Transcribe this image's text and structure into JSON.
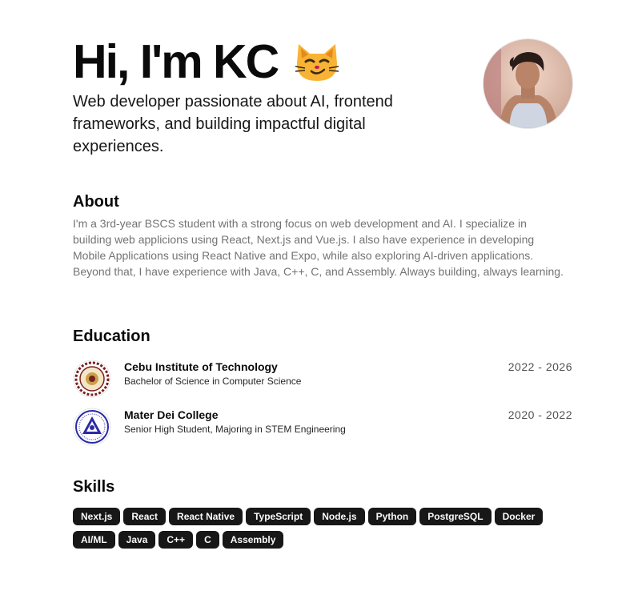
{
  "hero": {
    "title": "Hi, I'm KC",
    "emoji_icon": "smirking-cat-emoji-icon",
    "subtitle": "Web developer passionate about AI, frontend frameworks, and building impactful digital experiences."
  },
  "about": {
    "title": "About",
    "text": "I'm a 3rd-year BSCS student with a strong focus on web development and AI. I specialize in building web applicions using React, Next.js and Vue.js. I also have experience in developing Mobile Applications using React Native and Expo, while also exploring AI-driven applications. Beyond that, I have experience with Java, C++, C, and Assembly. Always building, always learning."
  },
  "education": {
    "title": "Education",
    "items": [
      {
        "school": "Cebu Institute of Technology",
        "degree": "Bachelor of Science in Computer Science",
        "years": "2022 - 2026",
        "logo_icon": "cit-seal-icon"
      },
      {
        "school": "Mater Dei College",
        "degree": "Senior High Student, Majoring in STEM Engineering",
        "years": "2020 - 2022",
        "logo_icon": "mdc-seal-icon"
      }
    ]
  },
  "skills": {
    "title": "Skills",
    "items": [
      "Next.js",
      "React",
      "React Native",
      "TypeScript",
      "Node.js",
      "Python",
      "PostgreSQL",
      "Docker",
      "AI/ML",
      "Java",
      "C++",
      "C",
      "Assembly"
    ]
  },
  "colors": {
    "badge_bg": "#171717",
    "badge_text": "#fafafa",
    "muted_text": "#737373",
    "emoji_yellow": "#f8b334"
  }
}
